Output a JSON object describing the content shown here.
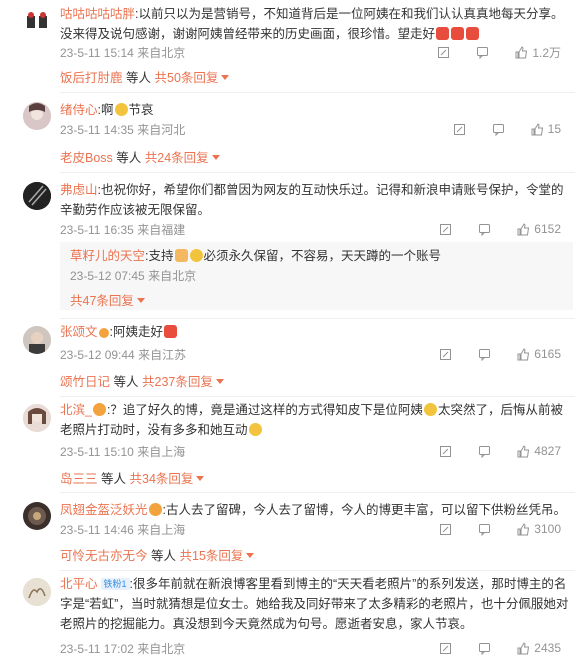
{
  "comments": [
    {
      "user": "咕咕咕咕咕胖",
      "text": ":以前只以为是营销号，不知道背后是一位阿姨在和我们认认真真地每天分享。没来得及说句感谢，谢谢阿姨曾经带来的历史画面，很珍惜。望走好",
      "date": "23-5-11 15:14",
      "location": "来自北京",
      "likes": "1.2万",
      "reply_user": "饭后打肘鹿",
      "reply_suffix": "等人",
      "reply_count": "共50条回复"
    },
    {
      "user": "绪侍心",
      "text": ":啊",
      "text_after": "节哀",
      "date": "23-5-11 14:35",
      "location": "来自河北",
      "likes": "15",
      "reply_user": "老皮Boss",
      "reply_suffix": "等人",
      "reply_count": "共24条回复"
    },
    {
      "user": "弗虑山",
      "text": ":也祝你好，希望你们都曾因为网友的互动快乐过。记得和新浪申请账号保护，令堂的辛勤劳作应该被无限保留。",
      "date": "23-5-11 16:35",
      "location": "来自福建",
      "likes": "6152",
      "sub_user": "草籽儿的天空",
      "sub_text_1": ":支持",
      "sub_text_2": "必须永久保留，不容易，天天蹲的一个账号",
      "sub_date": "23-5-12 07:45",
      "sub_location": "来自北京",
      "reply_count": "共47条回复"
    },
    {
      "user": "张颂文",
      "text": ":阿姨走好",
      "date": "23-5-12 09:44",
      "location": "来自江苏",
      "likes": "6165",
      "reply_user": "颂竹日记",
      "reply_suffix": "等人",
      "reply_count": "共237条回复"
    },
    {
      "user": "北滨_",
      "text": ":？追了好久的博，竟是通过这样的方式得知皮下是位阿姨",
      "text_after": "太突然了，后悔从前被老照片打动时，没有多多和她互动",
      "date": "23-5-11 15:10",
      "location": "来自上海",
      "likes": "4827",
      "reply_user": "岛三三",
      "reply_suffix": "等人",
      "reply_count": "共34条回复"
    },
    {
      "user": "凤翅金盔泛妖光",
      "text": ":古人去了留碑，今人去了留博，今人的博更丰富，可以留下供粉丝凭吊。",
      "date": "23-5-11 14:46",
      "location": "来自上海",
      "likes": "3100",
      "reply_user": "可怜无古亦无今",
      "reply_suffix": "等人",
      "reply_count": "共15条回复"
    },
    {
      "user": "北平心",
      "badge": "铁粉1",
      "text": ":很多年前就在新浪博客里看到博主的“天天看老照片”的系列发送，那时博主的名字是“若虹”，当时就猜想是位女士。她给我及同好带来了太多精彩的老照片，也十分佩服她对老照片的挖掘能力。真没想到今天竟然成为句号。愿逝者安息，家人节哀。",
      "date": "23-5-11 17:02",
      "location": "来自北京",
      "likes": "2435"
    }
  ],
  "colors": {
    "accent": "#eb7350",
    "meta": "#939393"
  }
}
